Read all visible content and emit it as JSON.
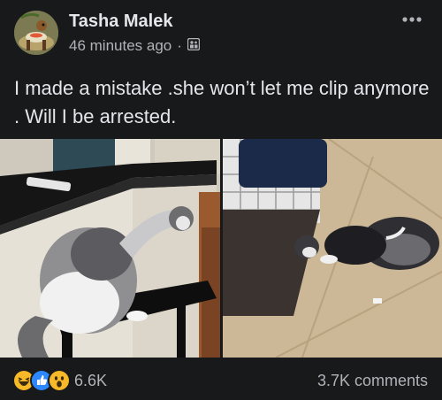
{
  "post": {
    "author": "Tasha Malek",
    "timestamp": "46 minutes ago",
    "separator": "·",
    "privacy_icon": "friends-icon",
    "text": "I made a mistake .she won’t let me clip anymore . Will I be arrested."
  },
  "photos": [
    {
      "name": "cat-on-stool-photo"
    },
    {
      "name": "cat-on-floor-photo"
    }
  ],
  "footer": {
    "reaction_icons": [
      "haha-icon",
      "like-icon",
      "wow-icon"
    ],
    "reaction_count": "6.6K",
    "comments": "3.7K comments"
  },
  "colors": {
    "background": "#18191a",
    "primary_text": "#e4e6eb",
    "secondary_text": "#b0b3b8",
    "like_blue": "#2d88ff",
    "reaction_yellow": "#f7b928"
  }
}
